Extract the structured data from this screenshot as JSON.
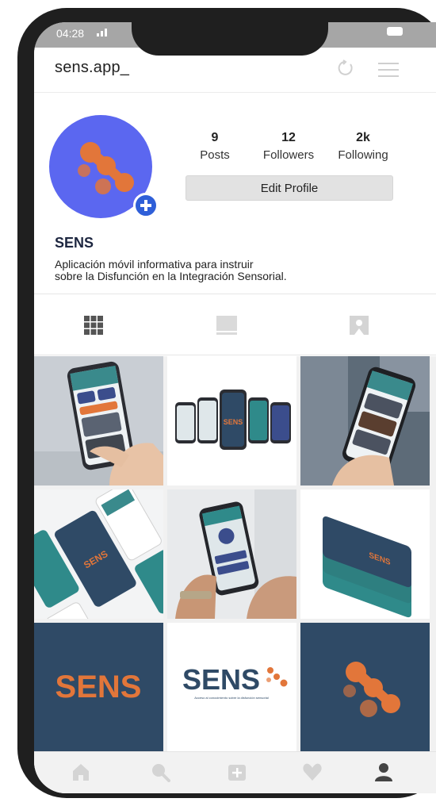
{
  "status_bar": {
    "time": "04:28"
  },
  "header": {
    "handle": "sens.app_"
  },
  "profile": {
    "name": "SENS",
    "bio_line1": "Aplicación móvil informativa para instruir",
    "bio_line2": "sobre la Disfunción en la Integración Sensorial.",
    "edit_label": "Edit Profile",
    "stats": [
      {
        "value": "9",
        "label": "Posts"
      },
      {
        "value": "12",
        "label": "Followers"
      },
      {
        "value": "2k",
        "label": "Following"
      }
    ]
  },
  "tabs": [
    "grid-icon",
    "feed-icon",
    "tagged-icon"
  ],
  "posts": [
    {
      "type": "photo",
      "caption": ""
    },
    {
      "type": "photo",
      "caption": "SENS"
    },
    {
      "type": "photo",
      "caption": ""
    },
    {
      "type": "photo",
      "caption": "SENS"
    },
    {
      "type": "photo",
      "caption": ""
    },
    {
      "type": "photo",
      "caption": "SENS"
    },
    {
      "type": "logo-dark",
      "caption": "SENS"
    },
    {
      "type": "logo-light",
      "caption": "SENS",
      "tagline": "Acceso al conocimiento sobre la disfunción sensorial"
    },
    {
      "type": "logo-mark",
      "caption": ""
    }
  ],
  "nav": [
    "home-icon",
    "search-icon",
    "add-icon",
    "heart-icon",
    "profile-icon"
  ],
  "colors": {
    "brand_navy": "#2f4a66",
    "brand_orange": "#e2763a",
    "avatar_blue": "#5b67f0",
    "teal": "#2f8a8a"
  }
}
